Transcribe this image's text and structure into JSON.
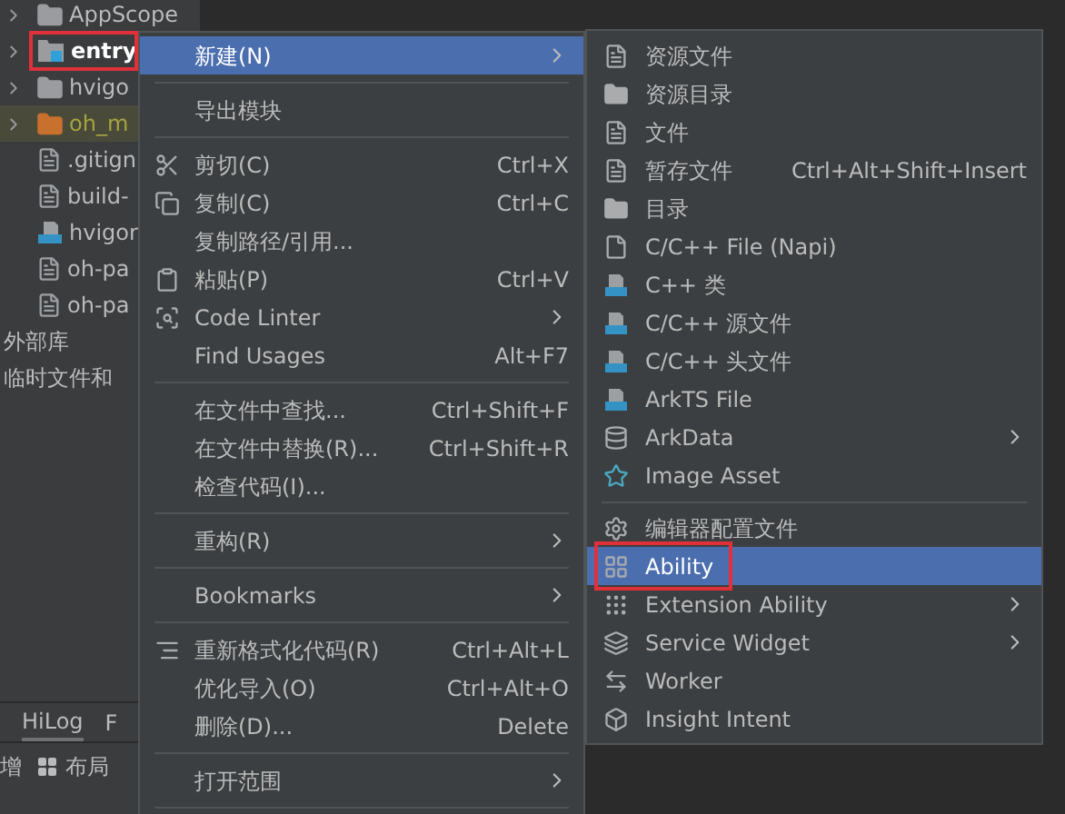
{
  "project_tree": [
    {
      "label": "AppScope",
      "kind": "folder",
      "outlined": false
    },
    {
      "label": "entry",
      "kind": "module",
      "outlined": true
    },
    {
      "label": "hvigo",
      "kind": "folder",
      "outlined": false
    },
    {
      "label": "oh_m",
      "kind": "excluded",
      "outlined": false
    },
    {
      "label": ".gitign",
      "kind": "ignore",
      "outlined": false
    },
    {
      "label": "build-",
      "kind": "json",
      "outlined": false
    },
    {
      "label": "hvigor",
      "kind": "ts",
      "outlined": false
    },
    {
      "label": "oh-pa",
      "kind": "json",
      "outlined": false
    },
    {
      "label": "oh-pa",
      "kind": "json",
      "outlined": false
    },
    {
      "label": "外部库",
      "kind": "plain",
      "outlined": false
    },
    {
      "label": "临时文件和",
      "kind": "plain",
      "outlined": false
    }
  ],
  "bottom_tabs": [
    {
      "label": "HiLog",
      "selected": true
    },
    {
      "label": "F",
      "selected": false
    }
  ],
  "bottom_toolbar": [
    {
      "label": "增",
      "kind": "text"
    },
    {
      "label": "布局",
      "kind": "grid"
    }
  ],
  "context_menu": [
    {
      "kind": "item",
      "label": "新建(N)",
      "submenu": true,
      "selected": true
    },
    {
      "kind": "separator"
    },
    {
      "kind": "item",
      "label": "导出模块",
      "submenu": false,
      "selected": false
    },
    {
      "kind": "separator"
    },
    {
      "kind": "item",
      "label": "剪切(C)",
      "shortcut": "Ctrl+X",
      "submenu": false,
      "selected": false
    },
    {
      "kind": "item",
      "label": "复制(C)",
      "shortcut": "Ctrl+C",
      "submenu": false,
      "selected": false
    },
    {
      "kind": "item",
      "label": "复制路径/引用...",
      "submenu": false,
      "selected": false
    },
    {
      "kind": "item",
      "label": "粘贴(P)",
      "shortcut": "Ctrl+V",
      "submenu": false,
      "selected": false
    },
    {
      "kind": "item",
      "label": "Code Linter",
      "submenu": true,
      "selected": false
    },
    {
      "kind": "item",
      "label": "Find Usages",
      "shortcut": "Alt+F7",
      "submenu": false,
      "selected": false
    },
    {
      "kind": "separator"
    },
    {
      "kind": "item",
      "label": "在文件中查找...",
      "shortcut": "Ctrl+Shift+F",
      "submenu": false,
      "selected": false
    },
    {
      "kind": "item",
      "label": "在文件中替换(R)...",
      "shortcut": "Ctrl+Shift+R",
      "submenu": false,
      "selected": false
    },
    {
      "kind": "item",
      "label": "检查代码(I)...",
      "submenu": false,
      "selected": false
    },
    {
      "kind": "separator"
    },
    {
      "kind": "item",
      "label": "重构(R)",
      "submenu": true,
      "selected": false
    },
    {
      "kind": "separator"
    },
    {
      "kind": "item",
      "label": "Bookmarks",
      "submenu": true,
      "selected": false
    },
    {
      "kind": "separator"
    },
    {
      "kind": "item",
      "label": "重新格式化代码(R)",
      "shortcut": "Ctrl+Alt+L",
      "submenu": false,
      "selected": false
    },
    {
      "kind": "item",
      "label": "优化导入(O)",
      "shortcut": "Ctrl+Alt+O",
      "submenu": false,
      "selected": false
    },
    {
      "kind": "item",
      "label": "删除(D)...",
      "shortcut": "Delete",
      "submenu": false,
      "selected": false
    },
    {
      "kind": "separator"
    },
    {
      "kind": "item",
      "label": "打开范围",
      "submenu": true,
      "selected": false
    },
    {
      "kind": "separator"
    }
  ],
  "new_submenu": [
    {
      "kind": "item",
      "label": "资源文件",
      "submenu": false,
      "selected": false,
      "outlined": false
    },
    {
      "kind": "item",
      "label": "资源目录",
      "submenu": false,
      "selected": false,
      "outlined": false
    },
    {
      "kind": "item",
      "label": "文件",
      "submenu": false,
      "selected": false,
      "outlined": false
    },
    {
      "kind": "item",
      "label": "暂存文件",
      "shortcut": "Ctrl+Alt+Shift+Insert",
      "submenu": false,
      "selected": false,
      "outlined": false
    },
    {
      "kind": "item",
      "label": "目录",
      "submenu": false,
      "selected": false,
      "outlined": false
    },
    {
      "kind": "item",
      "label": "C/C++ File (Napi)",
      "submenu": false,
      "selected": false,
      "outlined": false
    },
    {
      "kind": "item",
      "label": "C++ 类",
      "submenu": false,
      "selected": false,
      "outlined": false
    },
    {
      "kind": "item",
      "label": "C/C++ 源文件",
      "submenu": false,
      "selected": false,
      "outlined": false
    },
    {
      "kind": "item",
      "label": "C/C++ 头文件",
      "submenu": false,
      "selected": false,
      "outlined": false
    },
    {
      "kind": "item",
      "label": "ArkTS File",
      "submenu": false,
      "selected": false,
      "outlined": false
    },
    {
      "kind": "item",
      "label": "ArkData",
      "submenu": true,
      "selected": false,
      "outlined": false
    },
    {
      "kind": "item",
      "label": "Image Asset",
      "submenu": false,
      "selected": false,
      "outlined": false
    },
    {
      "kind": "separator"
    },
    {
      "kind": "item",
      "label": "编辑器配置文件",
      "submenu": false,
      "selected": false,
      "outlined": false
    },
    {
      "kind": "item",
      "label": "Ability",
      "submenu": false,
      "selected": true,
      "outlined": true
    },
    {
      "kind": "item",
      "label": "Extension Ability",
      "submenu": true,
      "selected": false,
      "outlined": false
    },
    {
      "kind": "item",
      "label": "Service Widget",
      "submenu": true,
      "selected": false,
      "outlined": false
    },
    {
      "kind": "item",
      "label": "Worker",
      "submenu": false,
      "selected": false,
      "outlined": false
    },
    {
      "kind": "item",
      "label": "Insight Intent",
      "submenu": false,
      "selected": false,
      "outlined": false
    }
  ]
}
